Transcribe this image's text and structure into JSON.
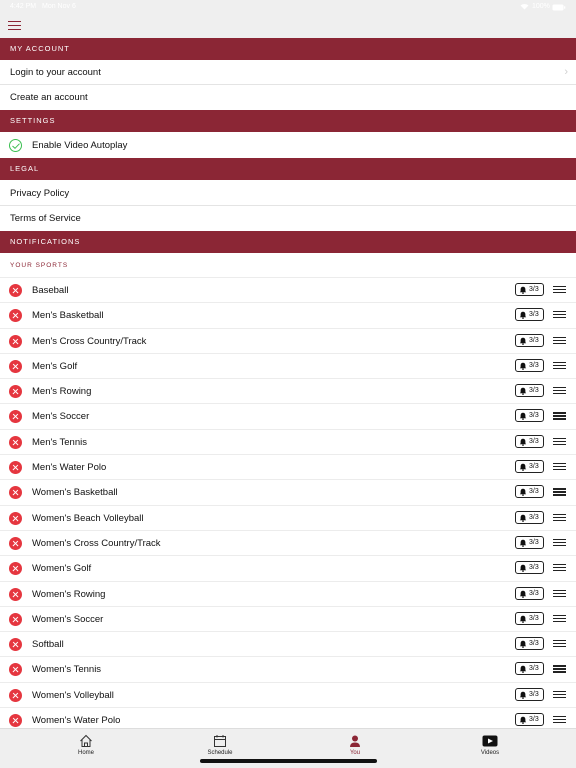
{
  "status_bar": {
    "time": "4:42 PM",
    "date": "Mon Nov 6",
    "battery": "100%"
  },
  "sections": {
    "account": {
      "title": "MY ACCOUNT",
      "items": [
        "Login to your account",
        "Create an account"
      ]
    },
    "settings": {
      "title": "SETTINGS",
      "autoplay_label": "Enable Video Autoplay",
      "autoplay_enabled": true
    },
    "legal": {
      "title": "LEGAL",
      "items": [
        "Privacy Policy",
        "Terms of Service"
      ]
    },
    "notifications": {
      "title": "NOTIFICATIONS",
      "subtitle": "YOUR SPORTS"
    }
  },
  "sports": [
    {
      "name": "Baseball",
      "alerts": "3/3"
    },
    {
      "name": "Men's Basketball",
      "alerts": "3/3"
    },
    {
      "name": "Men's Cross Country/Track",
      "alerts": "3/3"
    },
    {
      "name": "Men's Golf",
      "alerts": "3/3"
    },
    {
      "name": "Men's Rowing",
      "alerts": "3/3"
    },
    {
      "name": "Men's Soccer",
      "alerts": "3/3"
    },
    {
      "name": "Men's Tennis",
      "alerts": "3/3"
    },
    {
      "name": "Men's Water Polo",
      "alerts": "3/3"
    },
    {
      "name": "Women's Basketball",
      "alerts": "3/3"
    },
    {
      "name": "Women's Beach Volleyball",
      "alerts": "3/3"
    },
    {
      "name": "Women's Cross Country/Track",
      "alerts": "3/3"
    },
    {
      "name": "Women's Golf",
      "alerts": "3/3"
    },
    {
      "name": "Women's Rowing",
      "alerts": "3/3"
    },
    {
      "name": "Women's Soccer",
      "alerts": "3/3"
    },
    {
      "name": "Softball",
      "alerts": "3/3"
    },
    {
      "name": "Women's Tennis",
      "alerts": "3/3"
    },
    {
      "name": "Women's Volleyball",
      "alerts": "3/3"
    },
    {
      "name": "Women's Water Polo",
      "alerts": "3/3"
    }
  ],
  "tabs": [
    {
      "label": "Home",
      "icon": "home-icon"
    },
    {
      "label": "Schedule",
      "icon": "calendar-icon"
    },
    {
      "label": "You",
      "icon": "person-icon",
      "active": true
    },
    {
      "label": "Videos",
      "icon": "play-icon"
    }
  ],
  "colors": {
    "brand": "#8b2635",
    "remove": "#e5363f",
    "check": "#3cbf52"
  }
}
